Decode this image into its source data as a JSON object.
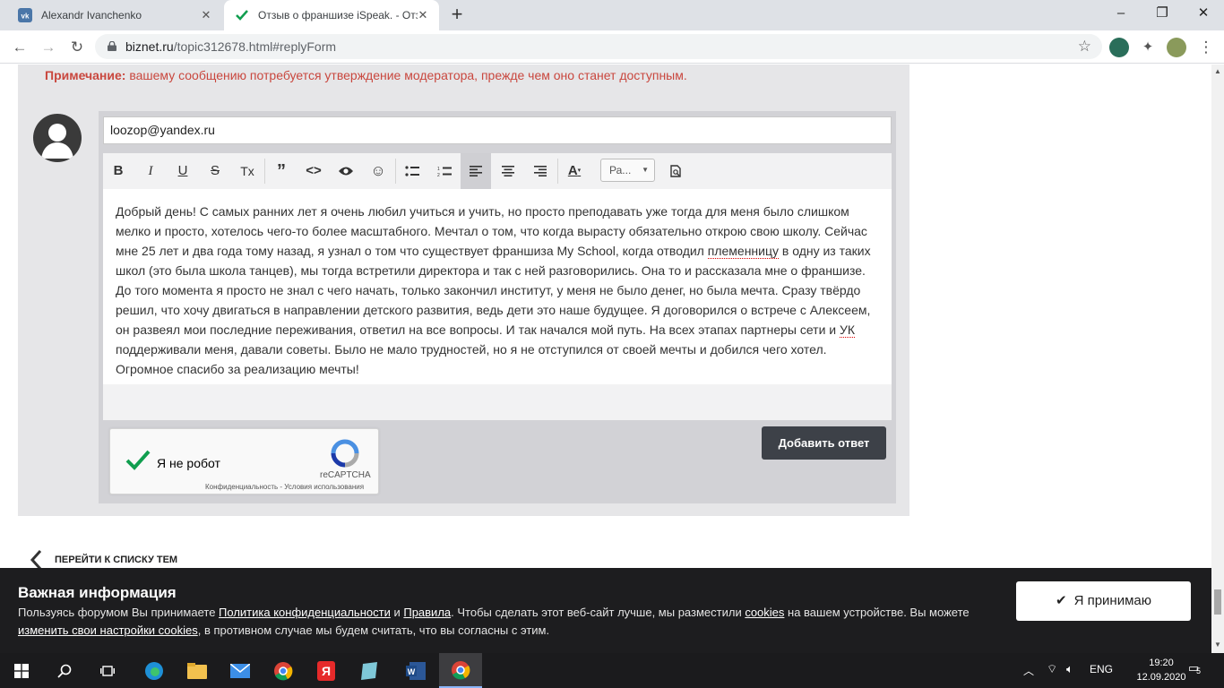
{
  "browser": {
    "tabs": [
      {
        "title": "Alexandr Ivanchenko",
        "active": false
      },
      {
        "title": "Отзыв о франшизе iSpeak. - Отз",
        "active": true
      }
    ],
    "url_host": "biznet.ru",
    "url_path": "/topic312678.html#replyForm",
    "window_controls": [
      "–",
      "❐",
      "✕"
    ]
  },
  "reply_form": {
    "note_label": "Примечание:",
    "note_text": " вашему сообщению потребуется утверждение модератора, прежде чем оно станет доступным.",
    "email": "loozop@yandex.ru",
    "font_select": "Ра...",
    "toolbar": [
      "B",
      "I",
      "U",
      "S",
      "Tx",
      "quote",
      "code",
      "preview",
      "emoji",
      "bullets",
      "numbered",
      "align-left",
      "align-center",
      "align-right",
      "text-color",
      "font",
      "print-preview"
    ],
    "message_parts": [
      "Добрый день! С самых ранних лет я очень любил учиться и учить, но просто преподавать уже тогда для меня было слишком мелко и просто, хотелось чего-то более масштабного. Мечтал о том, что когда вырасту обязательно открою свою школу. Сейчас мне 25 лет и два года тому назад, я узнал о том что существует франшиза My School, когда отводил ",
      "племенницу",
      " в одну из таких школ (это была школа танцев), мы тогда встретили директора и так с ней разговорились. Она то и рассказала мне о франшизе. До того момента я просто не знал с чего начать, только закончил институт, у меня не было денег, но была мечта. Сразу твёрдо решил, что хочу двигаться в направлении детского развития, ведь дети это наше будущее. Я договорился о встрече с Алексеем, он развеял мои последние переживания, ответил на все вопросы. И так начался мой путь. На всех этапах партнеры сети и ",
      "УК",
      " поддерживали меня, давали советы. Было не мало трудностей, но я не отступился от своей мечты и добился чего хотел. Огромное спасибо за реализацию мечты!"
    ],
    "captcha": {
      "label": "Я не робот",
      "brand": "reCAPTCHA",
      "links": "Конфиденциальность - Условия использования"
    },
    "submit": "Добавить ответ",
    "back_link": "ПЕРЕЙТИ К СПИСКУ ТЕМ"
  },
  "cookie_banner": {
    "title": "Важная информация",
    "text1": "Пользуясь форумом Вы принимаете ",
    "link_policy": "Политика конфиденциальности",
    "text2": " и ",
    "link_rules": "Правила",
    "text3": ". Чтобы сделать этот веб-сайт лучше, мы разместили ",
    "link_cookies": "cookies",
    "text4": " на вашем устройстве. Вы можете ",
    "link_settings": "изменить свои настройки cookies",
    "text5": ", в противном случае мы будем считать, что вы согласны с этим.",
    "accept": "Я принимаю"
  },
  "taskbar": {
    "lang": "ENG",
    "time": "19:20",
    "date": "12.09.2020",
    "notifications": "5"
  },
  "colors": {
    "note": "#c9473e",
    "submit_bg": "#3d4148",
    "cookie_bg": "#1d1d1f",
    "captcha_check": "#109e4f"
  }
}
